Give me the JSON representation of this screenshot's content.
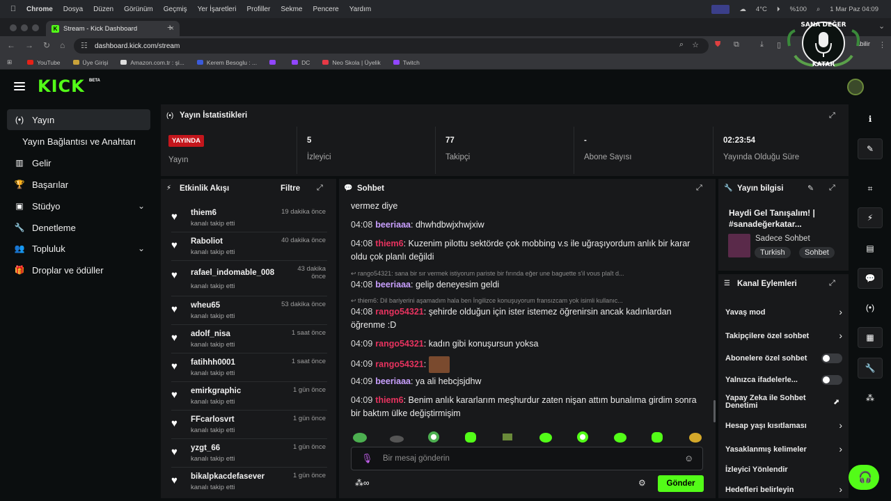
{
  "menubar": {
    "apple": "",
    "app": "Chrome",
    "items": [
      "Dosya",
      "Düzen",
      "Görünüm",
      "Geçmiş",
      "Yer İşaretleri",
      "Profiller",
      "Sekme",
      "Pencere",
      "Yardım"
    ],
    "weather": "4°C",
    "battery": "%100",
    "clock": "1 Mar Paz  04:09"
  },
  "browser": {
    "tab_title": "Stream - Kick Dashboard",
    "url": "dashboard.kick.com/stream",
    "update_label": "abilir",
    "bookmarks": [
      "YouTube",
      "Üye Girişi",
      "Amazon.com.tr : şi...",
      "Kerem Besoglu : ...",
      "",
      "DC",
      "Neo Skola | Üyelik",
      "Twitch"
    ]
  },
  "overlay": {
    "top": "SANA DEĞER",
    "bottom": "KATAR"
  },
  "header": {
    "logo": "KICK",
    "beta": "BETA"
  },
  "sidebar": {
    "items": [
      {
        "icon": "(•)",
        "label": "Yayın"
      },
      {
        "label": "Yayın Bağlantısı ve Anahtarı"
      },
      {
        "icon": "▥",
        "label": "Gelir"
      },
      {
        "icon": "🏆",
        "label": "Başarılar"
      },
      {
        "icon": "▣",
        "label": "Stüdyo"
      },
      {
        "icon": "🔧",
        "label": "Denetleme"
      },
      {
        "icon": "👥",
        "label": "Topluluk"
      },
      {
        "icon": "🎁",
        "label": "Droplar ve ödüller"
      }
    ]
  },
  "stats": {
    "title": "Yayın İstatistikleri",
    "live_badge": "YAYINDA",
    "cols": [
      {
        "value": "",
        "label": "Yayın"
      },
      {
        "value": "5",
        "label": "İzleyici"
      },
      {
        "value": "77",
        "label": "Takipçi"
      },
      {
        "value": "-",
        "label": "Abone Sayısı"
      },
      {
        "value": "02:23:54",
        "label": "Yayında Olduğu Süre"
      }
    ]
  },
  "activity": {
    "title": "Etkinlik Akışı",
    "filter": "Filtre",
    "items": [
      {
        "user": "thiem6",
        "action": "kanalı takip etti",
        "time": "19 dakika önce"
      },
      {
        "user": "Raboliot",
        "action": "kanalı takip etti",
        "time": "40 dakika önce"
      },
      {
        "user": "rafael_indomable_008",
        "action": "kanalı takip etti",
        "time": "43 dakika önce"
      },
      {
        "user": "wheu65",
        "action": "kanalı takip etti",
        "time": "53 dakika önce"
      },
      {
        "user": "adolf_nisa",
        "action": "kanalı takip etti",
        "time": "1 saat önce"
      },
      {
        "user": "fatihhh0001",
        "action": "kanalı takip etti",
        "time": "1 saat önce"
      },
      {
        "user": "emirkgraphic",
        "action": "kanalı takip etti",
        "time": "1 gün önce"
      },
      {
        "user": "FFcarlosvrt",
        "action": "kanalı takip etti",
        "time": "1 gün önce"
      },
      {
        "user": "yzgt_66",
        "action": "kanalı takip etti",
        "time": "1 gün önce"
      },
      {
        "user": "bikalpkacdefasever",
        "action": "kanalı takip etti",
        "time": "1 gün önce"
      }
    ]
  },
  "chat": {
    "title": "Sohbet",
    "lead": "vermez diye",
    "messages": [
      {
        "time": "04:08",
        "user": "beeriaaa",
        "color": "#c9a0ff",
        "text": "dhwhdbwjxhwjxiw"
      },
      {
        "time": "04:08",
        "user": "thiem6",
        "color": "#e8335f",
        "text": "Kuzenim pilottu sektörde çok mobbing v.s ile uğraşıyordum anlık bir karar oldu çok planlı değildi"
      },
      {
        "reply": "rango54321: sana bir sır vermek istiyorum pariste bir fırında eğer une baguette s'il vous plaît d..."
      },
      {
        "time": "04:08",
        "user": "beeriaaa",
        "color": "#c9a0ff",
        "text": "gelip deneyesim geldi"
      },
      {
        "reply": "thiem6: Dil bariyerini aşamadım hala ben İngilizce konuşuyorum fransızcam yok isimli kullanıc..."
      },
      {
        "time": "04:08",
        "user": "rango54321",
        "color": "#e8335f",
        "text": "şehirde olduğun için ister istemez öğrenirsin ancak kadınlardan öğrenme :D"
      },
      {
        "time": "04:09",
        "user": "rango54321",
        "color": "#e8335f",
        "text": "kadın gibi konuşursun yoksa"
      },
      {
        "time": "04:09",
        "user": "rango54321",
        "color": "#e8335f",
        "text": ""
      },
      {
        "time": "04:09",
        "user": "beeriaaa",
        "color": "#c9a0ff",
        "text": "ya ali hebcjsjdhw"
      },
      {
        "time": "04:09",
        "user": "thiem6",
        "color": "#e8335f",
        "text": "Benim anlık kararlarım meşhurdur zaten nişan attım bunalıma girdim sonra bir baktım ülke değiştirmişim"
      }
    ],
    "input_placeholder": "Bir mesaj gönderin",
    "send": "Gönder"
  },
  "stream_info": {
    "title": "Yayın bilgisi",
    "stream_title": "Haydi Gel Tanışalım! | #sanadeğerkatar...",
    "category": "Sadece Sohbet",
    "tags": [
      "Turkish",
      "Sohbet"
    ]
  },
  "channel_actions": {
    "title": "Kanal Eylemleri",
    "items": [
      {
        "label": "Yavaş mod",
        "kind": "arrow"
      },
      {
        "label": "Takipçilere özel sohbet",
        "kind": "arrow"
      },
      {
        "label": "Abonelere özel sohbet",
        "kind": "toggle"
      },
      {
        "label": "Yalnızca ifadelerle...",
        "kind": "toggle"
      },
      {
        "label": "Yapay Zeka ile Sohbet Denetimi",
        "kind": "ext"
      },
      {
        "label": "Hesap yaşı kısıtlaması",
        "kind": "arrow"
      },
      {
        "label": "Yasaklanmış kelimeler",
        "kind": "arrow"
      },
      {
        "label": "İzleyici Yönlendir",
        "kind": "none"
      },
      {
        "label": "Hedefleri belirleyin",
        "kind": "arrow"
      }
    ]
  },
  "colors": {
    "accent": "#53fc18",
    "live": "#c4161c",
    "panel": "#18191b",
    "bg": "#0b0e0f"
  }
}
